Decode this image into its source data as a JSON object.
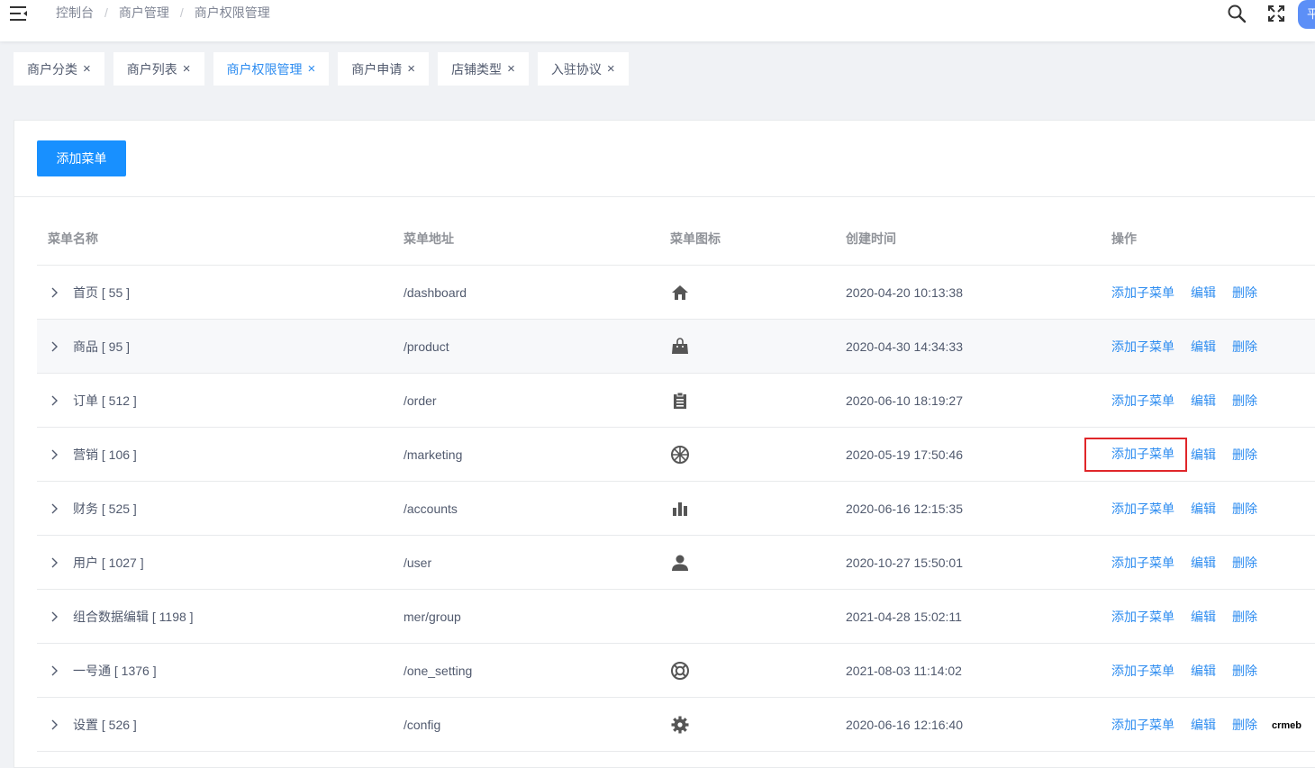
{
  "breadcrumb": [
    "控制台",
    "商户管理",
    "商户权限管理"
  ],
  "header": {
    "avatar_text": "平"
  },
  "tags": [
    {
      "label": "商户分类",
      "active": false
    },
    {
      "label": "商户列表",
      "active": false
    },
    {
      "label": "商户权限管理",
      "active": true
    },
    {
      "label": "商户申请",
      "active": false
    },
    {
      "label": "店铺类型",
      "active": false
    },
    {
      "label": "入驻协议",
      "active": false
    }
  ],
  "add_button": "添加菜单",
  "table": {
    "headers": [
      "菜单名称",
      "菜单地址",
      "菜单图标",
      "创建时间",
      "操作"
    ],
    "ops": [
      "添加子菜单",
      "编辑",
      "删除"
    ],
    "rows": [
      {
        "name": "首页 [ 55 ]",
        "url": "/dashboard",
        "icon": "home-icon",
        "time": "2020-04-20 10:13:38"
      },
      {
        "name": "商品 [ 95 ]",
        "url": "/product",
        "icon": "shopping-bag-icon",
        "time": "2020-04-30 14:34:33"
      },
      {
        "name": "订单 [ 512 ]",
        "url": "/order",
        "icon": "clipboard-icon",
        "time": "2020-06-10 18:19:27"
      },
      {
        "name": "营销 [ 106 ]",
        "url": "/marketing",
        "icon": "aperture-icon",
        "time": "2020-05-19 17:50:46"
      },
      {
        "name": "财务 [ 525 ]",
        "url": "/accounts",
        "icon": "bar-chart-icon",
        "time": "2020-06-16 12:15:35"
      },
      {
        "name": "用户 [ 1027 ]",
        "url": "/user",
        "icon": "user-icon",
        "time": "2020-10-27 15:50:01"
      },
      {
        "name": "组合数据编辑 [ 1198 ]",
        "url": "mer/group",
        "icon": "",
        "time": "2021-04-28 15:02:11"
      },
      {
        "name": "一号通 [ 1376 ]",
        "url": "/one_setting",
        "icon": "lifebuoy-icon",
        "time": "2021-08-03 11:14:02"
      },
      {
        "name": "设置 [ 526 ]",
        "url": "/config",
        "icon": "gear-icon",
        "time": "2020-06-16 12:16:40"
      }
    ]
  },
  "highlighted_row_index": 3,
  "highlight_color": "#e0262a",
  "accent_color": "#2d8cf0",
  "watermark": "crmeb"
}
